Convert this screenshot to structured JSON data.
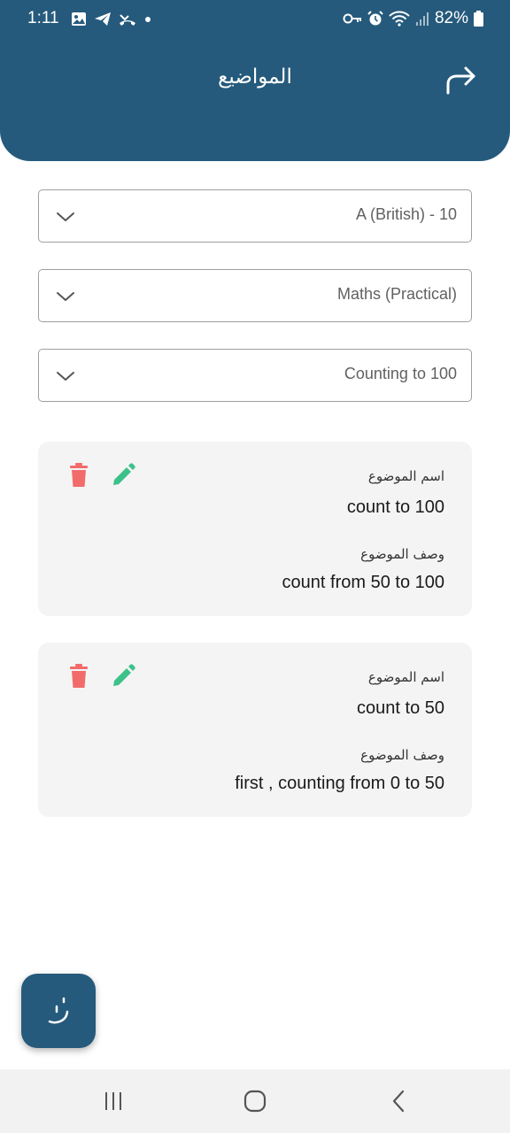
{
  "status_bar": {
    "time": "1:11",
    "battery": "82%",
    "left_icons": [
      "image-icon",
      "telegram-icon",
      "missed-call-icon",
      "dot-icon"
    ],
    "right_icons": [
      "key-icon",
      "alarm-icon",
      "wifi-icon",
      "signal-icon",
      "battery-icon"
    ]
  },
  "header": {
    "title": "المواضيع",
    "forward_icon": "forward-arrow-icon",
    "background_color": "#255a7c"
  },
  "filters": [
    {
      "value": "A (British) - 10",
      "icon": "chevron-down-icon"
    },
    {
      "value": "Maths (Practical)",
      "icon": "chevron-down-icon"
    },
    {
      "value": "Counting to 100",
      "icon": "chevron-down-icon"
    }
  ],
  "topics": [
    {
      "name_label": "اسم الموضوع",
      "name": "count to 100",
      "desc_label": "وصف الموضوع",
      "description": "count from 50 to 100"
    },
    {
      "name_label": "اسم الموضوع",
      "name": "count to 50",
      "desc_label": "وصف الموضوع",
      "description": "first , counting from 0 to 50"
    }
  ],
  "actions": {
    "delete_icon": "trash-icon",
    "edit_icon": "pencil-icon",
    "delete_color": "#f26b6b",
    "edit_color": "#3cc18a"
  },
  "fab": {
    "icon": "add-topic-icon",
    "color": "#255a7c"
  },
  "nav_bar": {
    "items": [
      "recent-apps-icon",
      "home-icon",
      "back-icon"
    ]
  }
}
